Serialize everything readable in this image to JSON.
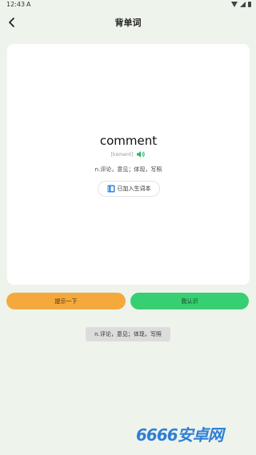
{
  "status_bar": {
    "time": "12:43",
    "notification": "A"
  },
  "header": {
    "title": "背单词"
  },
  "card": {
    "word": "comment",
    "phonetic": "[kɒment]",
    "meaning": "n.评论，意见；体现，写照",
    "added_label": "已加入生词本"
  },
  "actions": {
    "hint_label": "提示一下",
    "know_label": "我认识"
  },
  "reveal": {
    "text": "n.评论，意见；体现，写照"
  },
  "watermark": {
    "text": "6666安卓网",
    "sub": ""
  },
  "colors": {
    "hint": "#f5a93d",
    "know": "#36cf72",
    "speaker": "#2bb36b",
    "book": "#2f86e0"
  }
}
